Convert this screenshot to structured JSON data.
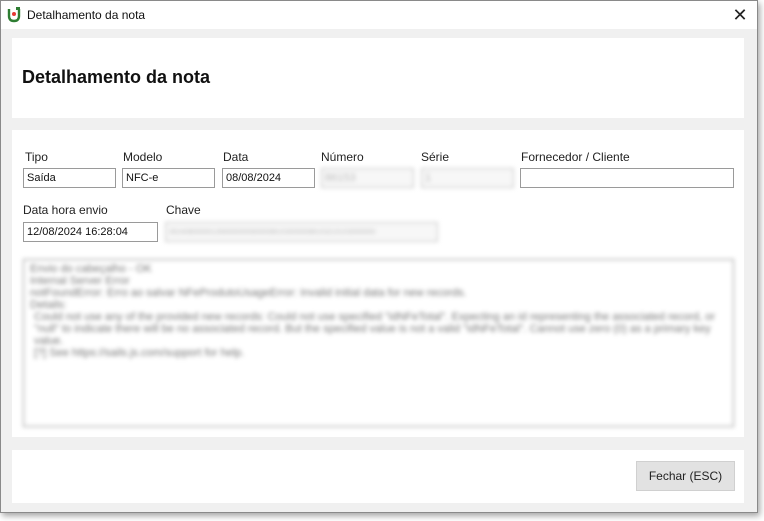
{
  "window": {
    "title": "Detalhamento da nota",
    "close_glyph": "✕"
  },
  "header": {
    "title": "Detalhamento da nota"
  },
  "form": {
    "tipo": {
      "label": "Tipo",
      "value": "Saída"
    },
    "modelo": {
      "label": "Modelo",
      "value": "NFC-e"
    },
    "data": {
      "label": "Data",
      "value": "08/08/2024"
    },
    "numero": {
      "label": "Número",
      "value": "86153"
    },
    "serie": {
      "label": "Série",
      "value": "1"
    },
    "fornecedor": {
      "label": "Fornecedor / Cliente",
      "value": ""
    },
    "data_hora_envio": {
      "label": "Data hora envio",
      "value": "12/08/2024 16:28:04"
    },
    "chave": {
      "label": "Chave",
      "value": "35240800000135650000590000861530000086153215153000000"
    }
  },
  "log": {
    "lines": [
      "Envio do cabeçalho - OK",
      "Internal Server Error",
      "notFoundError: Erro ao salvar NFeProdutoUsageError: Invalid initial data for new records.",
      "Details:",
      "  Could not use any of the provided new records: Could not use specified \"idNFeTotal\". Expecting an id representing the associated record, or \"null\" to indicate there will be no associated record. But the specified value is not a valid \"idNFeTotal\". Cannot use zero (0) as a primary key value.",
      "  [?] See https://sails.js.com/support for help."
    ]
  },
  "footer": {
    "close_label": "Fechar (ESC)"
  },
  "icons": {
    "app": "app-logo-icon",
    "close": "close-icon"
  }
}
